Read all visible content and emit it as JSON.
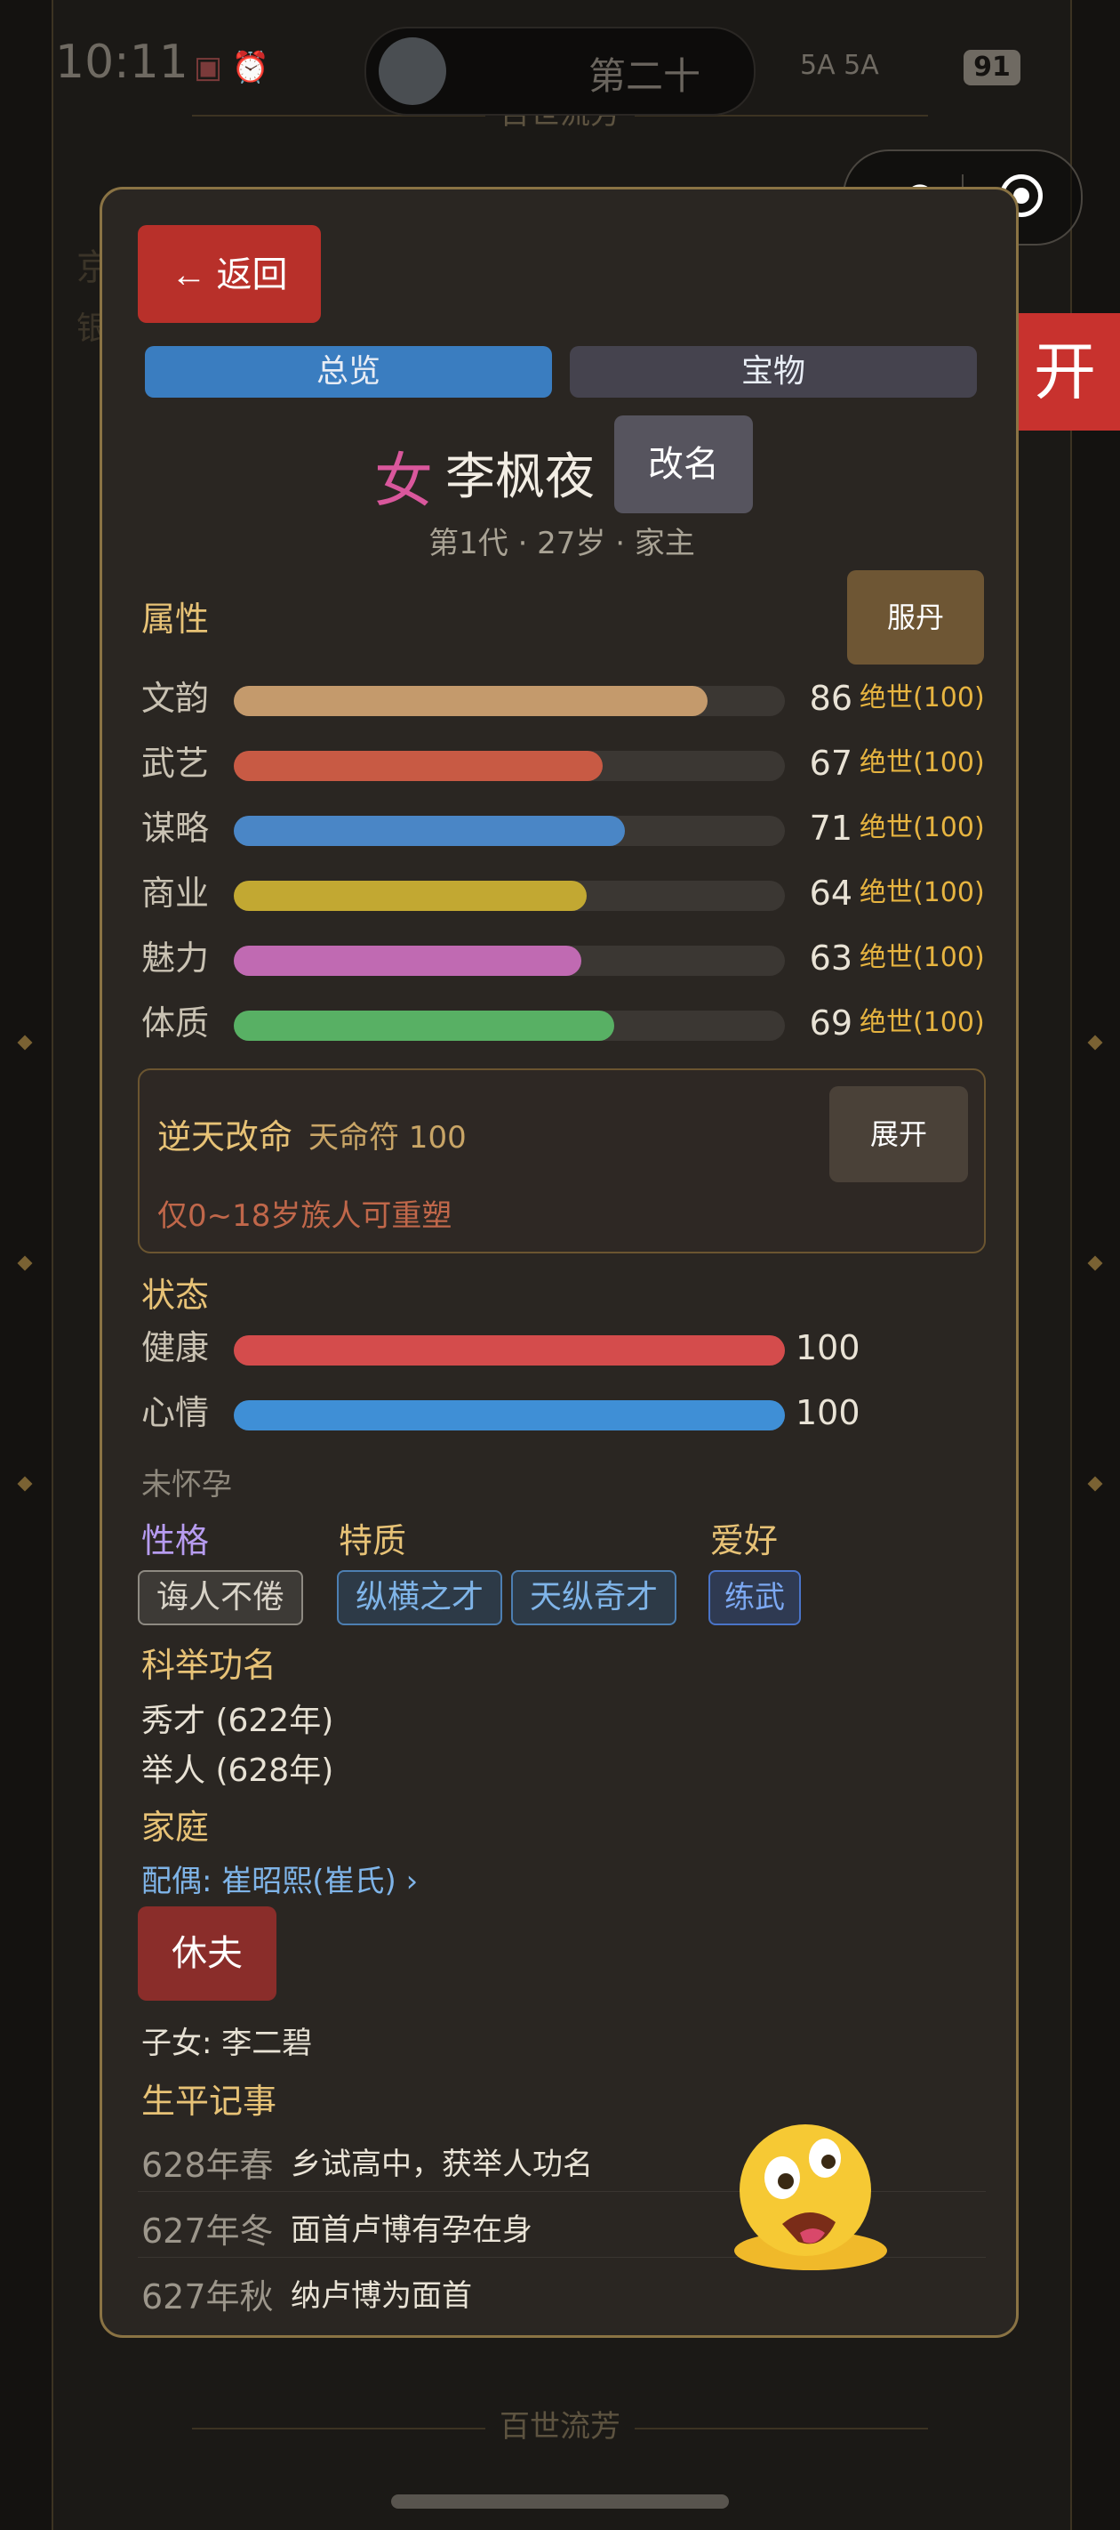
{
  "status_bar": {
    "time": "10:11",
    "island_text": "第二十",
    "network": "5A 5A",
    "battery": "91"
  },
  "background": {
    "title": "百世流芳",
    "bottom_title": "百世流芳",
    "ghost_line1": "京",
    "ghost_line2": "银"
  },
  "capsule": {
    "more_icon": "more-dots-icon",
    "close_icon": "target-icon"
  },
  "open_button": "开",
  "modal": {
    "back_button": "← 返回",
    "tabs": [
      {
        "label": "总览",
        "active": true
      },
      {
        "label": "宝物",
        "active": false
      }
    ],
    "character": {
      "gender": "女",
      "name": "李枫夜",
      "rename_button": "改名",
      "subline": "第1代 · 27岁 · 家主"
    },
    "attributes": {
      "title": "属性",
      "pill_button": "服丹",
      "items": [
        {
          "label": "文韵",
          "value": "86",
          "cap": "绝世(100)",
          "fraction": 0.86,
          "color": "#c49a6c"
        },
        {
          "label": "武艺",
          "value": "67",
          "cap": "绝世(100)",
          "fraction": 0.67,
          "color": "#c85a44"
        },
        {
          "label": "谋略",
          "value": "71",
          "cap": "绝世(100)",
          "fraction": 0.71,
          "color": "#4a86c6"
        },
        {
          "label": "商业",
          "value": "64",
          "cap": "绝世(100)",
          "fraction": 0.64,
          "color": "#c2a832"
        },
        {
          "label": "魅力",
          "value": "63",
          "cap": "绝世(100)",
          "fraction": 0.63,
          "color": "#c06ab2"
        },
        {
          "label": "体质",
          "value": "69",
          "cap": "绝世(100)",
          "fraction": 0.69,
          "color": "#58b064"
        }
      ]
    },
    "fate": {
      "title": "逆天改命",
      "token": "天命符 100",
      "note": "仅0~18岁族人可重塑",
      "expand_button": "展开"
    },
    "status": {
      "title": "状态",
      "items": [
        {
          "label": "健康",
          "value": "100",
          "fraction": 1.0,
          "color": "#d44c4c"
        },
        {
          "label": "心情",
          "value": "100",
          "fraction": 1.0,
          "color": "#3f8fd6"
        }
      ],
      "pregnancy": "未怀孕"
    },
    "traits": {
      "personality_title": "性格",
      "quality_title": "特质",
      "hobby_title": "爱好",
      "personality": [
        "诲人不倦"
      ],
      "qualities": [
        "纵横之才",
        "天纵奇才"
      ],
      "hobbies": [
        "练武"
      ]
    },
    "exam": {
      "title": "科举功名",
      "items": [
        "秀才 (622年)",
        "举人 (628年)"
      ]
    },
    "family": {
      "title": "家庭",
      "spouse": "配偶: 崔昭熙(崔氏) ›",
      "divorce_button": "休夫",
      "children": "子女: 李二碧"
    },
    "events": {
      "title": "生平记事",
      "items": [
        {
          "date": "628年春",
          "text": "乡试高中，获举人功名"
        },
        {
          "date": "627年冬",
          "text": "面首卢博有孕在身"
        },
        {
          "date": "627年秋",
          "text": "纳卢博为面首"
        }
      ]
    }
  }
}
